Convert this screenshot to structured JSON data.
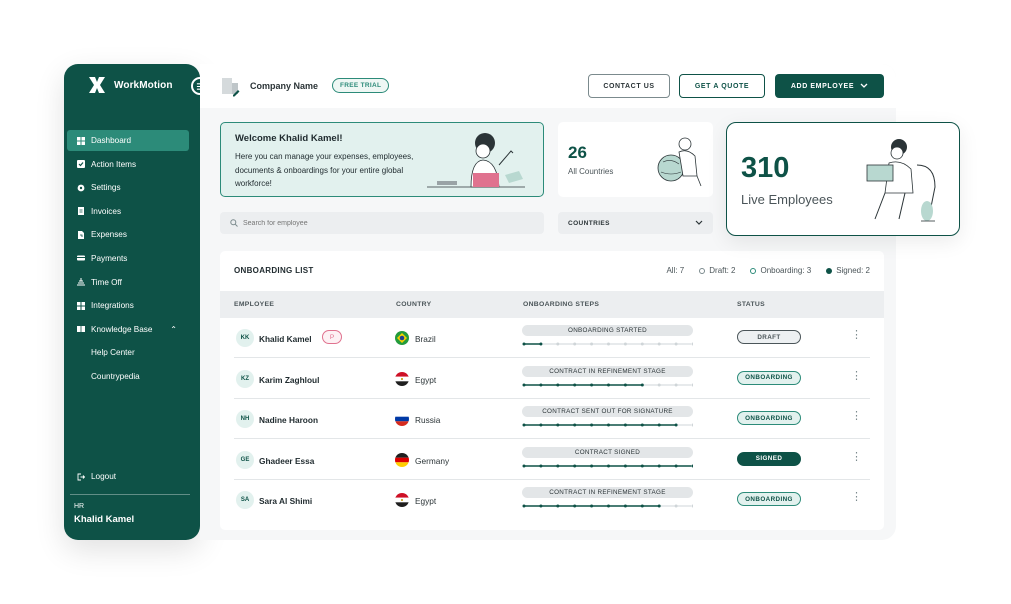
{
  "brand": {
    "name": "WorkMotion",
    "primary": "#0e5247",
    "accent": "#2c8b79"
  },
  "sidebar": {
    "items": [
      {
        "label": "Dashboard",
        "icon": "grid-icon",
        "active": true
      },
      {
        "label": "Action Items",
        "icon": "check-icon"
      },
      {
        "label": "Settings",
        "icon": "gear-icon"
      },
      {
        "label": "Invoices",
        "icon": "invoice-icon"
      },
      {
        "label": "Expenses",
        "icon": "expenses-icon"
      },
      {
        "label": "Payments",
        "icon": "payments-icon"
      },
      {
        "label": "Time Off",
        "icon": "time-off-icon"
      },
      {
        "label": "Integrations",
        "icon": "integrations-icon"
      },
      {
        "label": "Knowledge Base",
        "icon": "book-icon"
      },
      {
        "label": "Help Center",
        "icon": ""
      },
      {
        "label": "Countrypedia",
        "icon": ""
      }
    ],
    "logout": "Logout",
    "role": "HR",
    "user": "Khalid Kamel"
  },
  "topbar": {
    "company_name": "Company Name",
    "trial_badge": "FREE TRIAL",
    "contact": "CONTACT US",
    "quote": "GET A QUOTE",
    "add_employee": "ADD EMPLOYEE"
  },
  "welcome": {
    "title": "Welcome Khalid Kamel!",
    "text": "Here you can manage your expenses, employees, documents & onboardings for your entire global workforce!"
  },
  "stats": {
    "countries_value": "26",
    "countries_label": "All Countries",
    "live_value": "310",
    "live_label": "Live Employees"
  },
  "search": {
    "placeholder": "Search for employee"
  },
  "country_filter": {
    "label": "COUNTRIES"
  },
  "onboarding": {
    "title": "ONBOARDING LIST",
    "filters": {
      "all": "All: 7",
      "draft": "Draft: 2",
      "onboarding": "Onboarding: 3",
      "signed": "Signed: 2"
    },
    "columns": [
      "EMPLOYEE",
      "COUNTRY",
      "ONBOARDING STEPS",
      "STATUS"
    ],
    "rows": [
      {
        "initials": "KK",
        "name": "Khalid Kamel",
        "badge": "P",
        "country": "Brazil",
        "flag": "brazil-flag-icon",
        "step": "ONBOARDING STARTED",
        "progress": 0.1,
        "status": "DRAFT",
        "status_type": "draft"
      },
      {
        "initials": "KZ",
        "name": "Karim Zaghloul",
        "badge": "",
        "country": "Egypt",
        "flag": "egypt-flag-icon",
        "step": "CONTRACT IN REFINEMENT STAGE",
        "progress": 0.7,
        "status": "ONBOARDING",
        "status_type": "onboarding"
      },
      {
        "initials": "NH",
        "name": "Nadine Haroon",
        "badge": "",
        "country": "Russia",
        "flag": "russia-flag-icon",
        "step": "CONTRACT SENT OUT FOR SIGNATURE",
        "progress": 0.9,
        "status": "ONBOARDING",
        "status_type": "onboarding"
      },
      {
        "initials": "GE",
        "name": "Ghadeer Essa",
        "badge": "",
        "country": "Germany",
        "flag": "germany-flag-icon",
        "step": "CONTRACT SIGNED",
        "progress": 1.0,
        "status": "SIGNED",
        "status_type": "signed"
      },
      {
        "initials": "SA",
        "name": "Sara Al Shimi",
        "badge": "",
        "country": "Egypt",
        "flag": "egypt-flag-icon",
        "step": "CONTRACT IN REFINEMENT STAGE",
        "progress": 0.8,
        "status": "ONBOARDING",
        "status_type": "onboarding"
      }
    ]
  }
}
